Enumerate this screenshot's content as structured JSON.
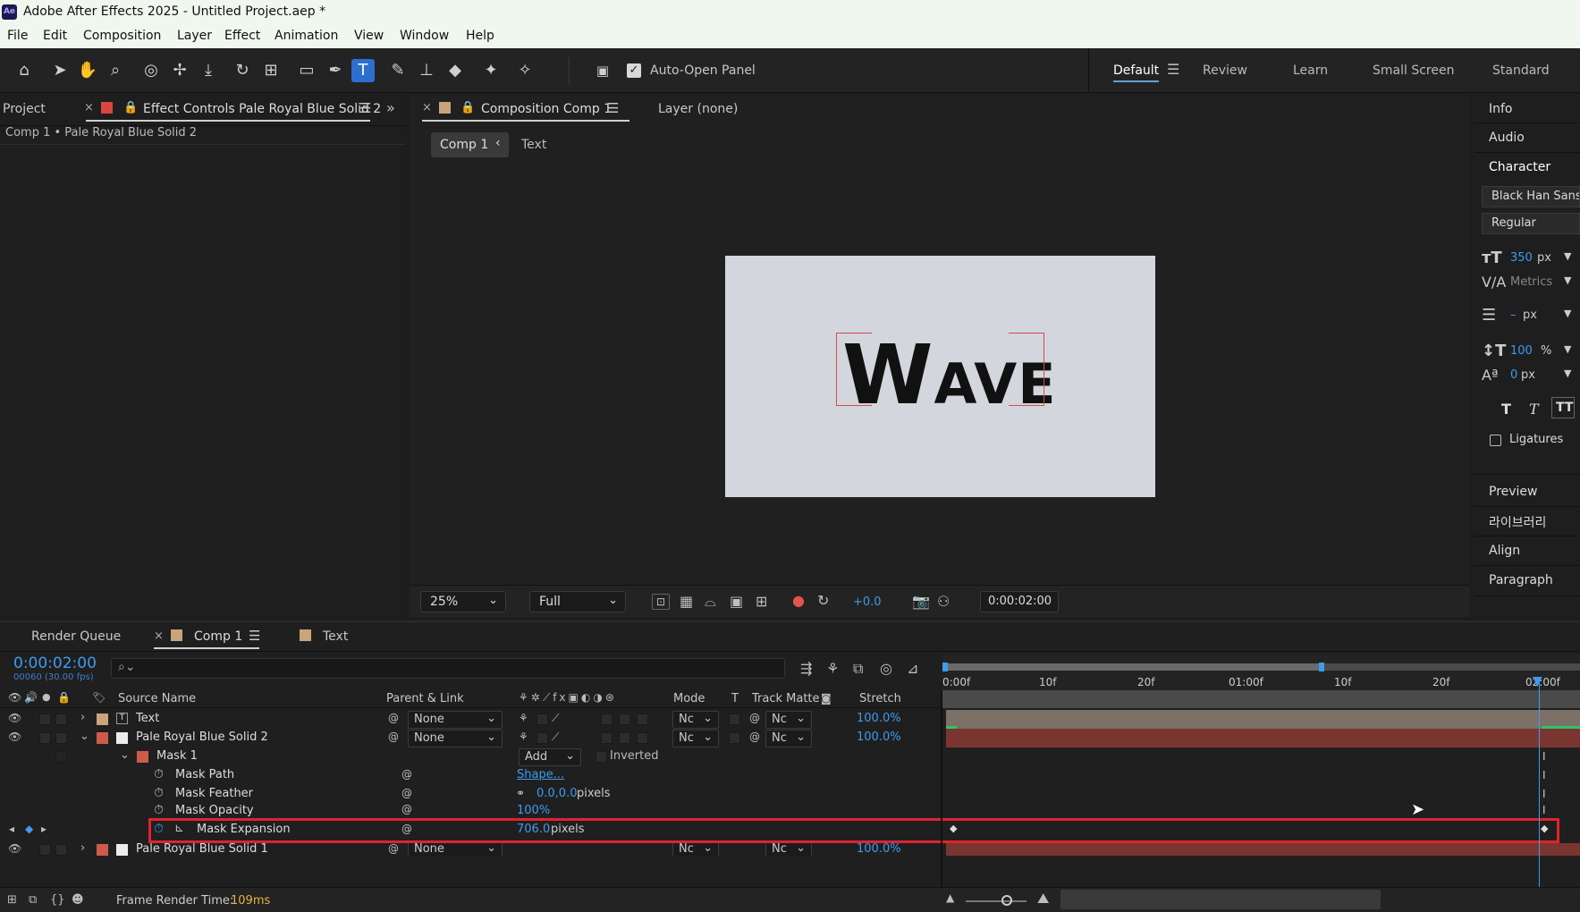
{
  "window": {
    "title": "Adobe After Effects 2025 - Untitled Project.aep *",
    "logo": "Ae"
  },
  "menu": [
    "File",
    "Edit",
    "Composition",
    "Layer",
    "Effect",
    "Animation",
    "View",
    "Window",
    "Help"
  ],
  "toolbar": {
    "auto_open_label": "Auto-Open Panel",
    "workspaces": [
      "Default",
      "Review",
      "Learn",
      "Small Screen",
      "Standard"
    ]
  },
  "left_panel": {
    "tab_project": "Project",
    "tab_effect_controls": "Effect Controls Pale Royal Blue Solid 2",
    "breadcrumb": "Comp 1 • Pale Royal Blue Solid 2"
  },
  "comp_panel": {
    "tab_composition": "Composition Comp 1",
    "tab_layer": "Layer (none)",
    "crumb_comp": "Comp 1",
    "crumb_text": "Text",
    "canvas_text_big": "W",
    "canvas_text_small": "AVE",
    "zoom": "25%",
    "resolution": "Full",
    "exposure": "+0.0",
    "timecode": "0:00:02:00"
  },
  "right_panel": {
    "info": "Info",
    "audio": "Audio",
    "character": "Character",
    "font": "Black Han Sans",
    "style": "Regular",
    "font_size": "350",
    "font_size_unit": "px",
    "kerning": "Metrics",
    "leading_value": "–",
    "leading_unit": "px",
    "vscale": "100",
    "vscale_unit": "%",
    "baseline": "0",
    "baseline_unit": "px",
    "ligatures": "Ligatures",
    "preview": "Preview",
    "library": "라이브러리",
    "align": "Align",
    "paragraph": "Paragraph"
  },
  "timeline": {
    "tab_render_queue": "Render Queue",
    "tab_comp": "Comp 1",
    "tab_text": "Text",
    "timecode": "0:00:02:00",
    "fps": "00060 (30.00 fps)",
    "search_placeholder": "",
    "headers": {
      "source_name": "Source Name",
      "parent_link": "Parent & Link",
      "mode": "Mode",
      "t": "T",
      "track_matte": "Track Matte",
      "stretch": "Stretch"
    },
    "ruler": [
      "0:00f",
      "10f",
      "20f",
      "01:00f",
      "10f",
      "20f",
      "02:00f"
    ],
    "layers": [
      {
        "name": "Text",
        "parent": "None",
        "mode": "Nc",
        "matte": "Nc",
        "stretch": "100.0%",
        "color": "#c9a57f"
      },
      {
        "name": "Pale Royal Blue Solid 2",
        "parent": "None",
        "mode": "Nc",
        "matte": "Nc",
        "stretch": "100.0%",
        "color": "#d05a4a"
      },
      {
        "name": "Pale Royal Blue Solid 1",
        "parent": "None",
        "mode": "Nc",
        "matte": "Nc",
        "stretch": "100.0%",
        "color": "#d05a4a"
      }
    ],
    "mask": {
      "name": "Mask 1",
      "mode": "Add",
      "inverted": "Inverted",
      "path_label": "Mask Path",
      "path_value": "Shape...",
      "feather_label": "Mask Feather",
      "feather_value": "0.0,0.0",
      "feather_unit": "pixels",
      "opacity_label": "Mask Opacity",
      "opacity_value": "100%",
      "expansion_label": "Mask Expansion",
      "expansion_value": "706.0",
      "expansion_unit": "pixels"
    },
    "frame_render_label": "Frame Render Time:",
    "frame_render_value": "109ms"
  },
  "colors": {
    "accent_blue": "#3d9bf0",
    "highlight_red": "#e0232f",
    "solid_track": "#7a3530",
    "text_track": "#7d7066"
  }
}
